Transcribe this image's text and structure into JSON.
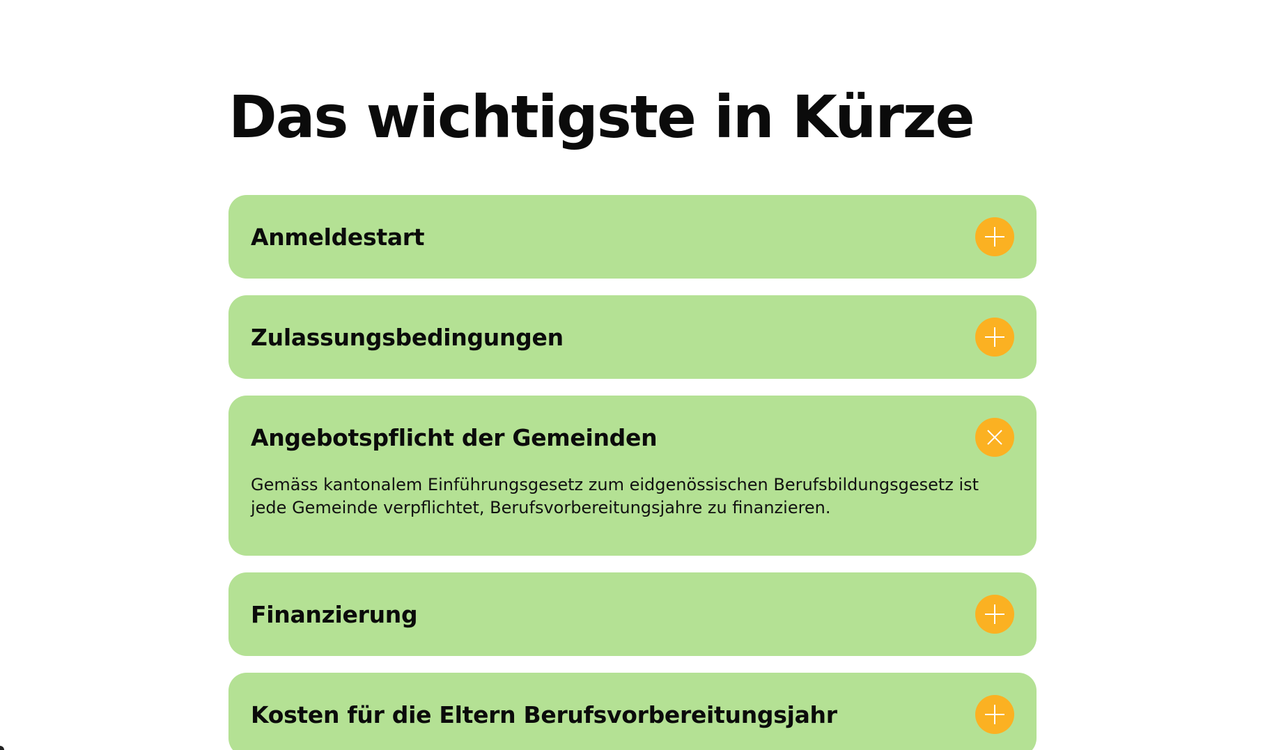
{
  "page": {
    "title": "Das wichtigste in Kürze"
  },
  "colors": {
    "panel": "#b4e194",
    "toggle": "#fbb122",
    "text": "#0b0b0b"
  },
  "accordion": {
    "items": [
      {
        "title": "Anmeldestart",
        "expanded": false,
        "icon": "plus-icon"
      },
      {
        "title": "Zulassungsbedingungen",
        "expanded": false,
        "icon": "plus-icon"
      },
      {
        "title": "Angebotspflicht der Gemeinden",
        "expanded": true,
        "icon": "close-icon",
        "body_line1": "Gemäss kantonalem Einführungsgesetz zum eidgenössischen Berufsbildungsgesetz ist",
        "body_line2": "jede Gemeinde verpflichtet, Berufsvorbereitungsjahre zu finanzieren."
      },
      {
        "title": "Finanzierung",
        "expanded": false,
        "icon": "plus-icon"
      },
      {
        "title": "Kosten für die Eltern Berufsvorbereitungsjahr",
        "expanded": false,
        "icon": "plus-icon"
      }
    ]
  }
}
